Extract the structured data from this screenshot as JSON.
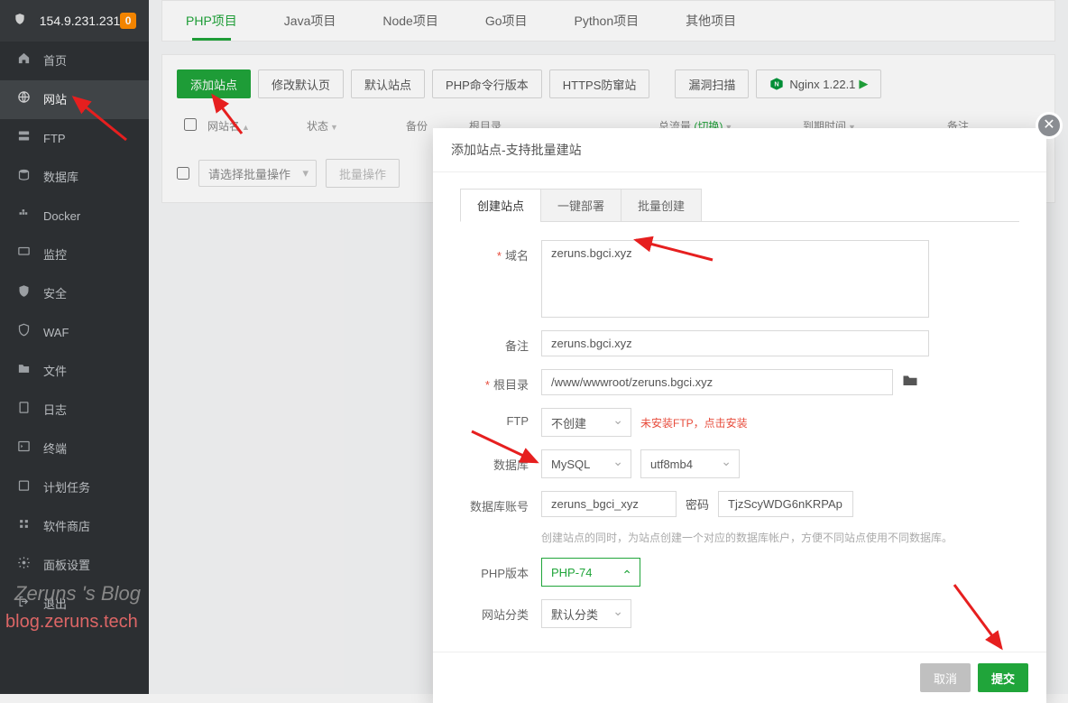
{
  "header": {
    "ip": "154.9.231.231",
    "badge": "0"
  },
  "sidebar": {
    "items": [
      {
        "icon": "home",
        "label": "首页"
      },
      {
        "icon": "globe",
        "label": "网站",
        "active": true
      },
      {
        "icon": "server",
        "label": "FTP"
      },
      {
        "icon": "db",
        "label": "数据库"
      },
      {
        "icon": "docker",
        "label": "Docker"
      },
      {
        "icon": "monitor",
        "label": "监控"
      },
      {
        "icon": "shield",
        "label": "安全"
      },
      {
        "icon": "waf",
        "label": "WAF"
      },
      {
        "icon": "folder",
        "label": "文件"
      },
      {
        "icon": "log",
        "label": "日志"
      },
      {
        "icon": "term",
        "label": "终端"
      },
      {
        "icon": "task",
        "label": "计划任务"
      },
      {
        "icon": "store",
        "label": "软件商店"
      },
      {
        "icon": "gear",
        "label": "面板设置"
      },
      {
        "icon": "exit",
        "label": "退出"
      }
    ]
  },
  "maintabs": [
    {
      "label": "PHP项目",
      "active": true
    },
    {
      "label": "Java项目"
    },
    {
      "label": "Node项目"
    },
    {
      "label": "Go项目"
    },
    {
      "label": "Python项目"
    },
    {
      "label": "其他项目"
    }
  ],
  "toolbar": {
    "add": "添加站点",
    "editDefault": "修改默认页",
    "defaultSite": "默认站点",
    "phpCli": "PHP命令行版本",
    "httpsGuard": "HTTPS防窜站",
    "vulScan": "漏洞扫描",
    "nginx": "Nginx 1.22.1"
  },
  "columns": {
    "name": "网站名",
    "status": "状态",
    "backup": "备份",
    "root": "根目录",
    "traffic": "总流量",
    "trafficSwitch": "(切换)",
    "expire": "到期时间",
    "remark": "备注"
  },
  "batch": {
    "selectPlaceholder": "请选择批量操作",
    "btn": "批量操作"
  },
  "modal": {
    "title": "添加站点-支持批量建站",
    "tabs": [
      {
        "label": "创建站点",
        "active": true
      },
      {
        "label": "一键部署"
      },
      {
        "label": "批量创建"
      }
    ],
    "labels": {
      "domain": "域名",
      "remark": "备注",
      "root": "根目录",
      "ftp": "FTP",
      "database": "数据库",
      "dbUser": "数据库账号",
      "password": "密码",
      "phpVer": "PHP版本",
      "siteCat": "网站分类"
    },
    "values": {
      "domain": "zeruns.bgci.xyz",
      "remark": "zeruns.bgci.xyz",
      "root": "/www/wwwroot/zeruns.bgci.xyz",
      "ftp": "不创建",
      "ftpWarn": "未安装FTP，点击安装",
      "db": "MySQL",
      "charset": "utf8mb4",
      "dbUser": "zeruns_bgci_xyz",
      "dbPass": "TjzScyWDG6nKRPAp",
      "dbHint": "创建站点的同时，为站点创建一个对应的数据库帐户，方便不同站点使用不同数据库。",
      "phpVer": "PHP-74",
      "siteCat": "默认分类"
    },
    "buttons": {
      "cancel": "取消",
      "submit": "提交"
    }
  },
  "watermark": {
    "line1": "Zeruns 's Blog",
    "line2": "blog.zeruns.tech"
  }
}
